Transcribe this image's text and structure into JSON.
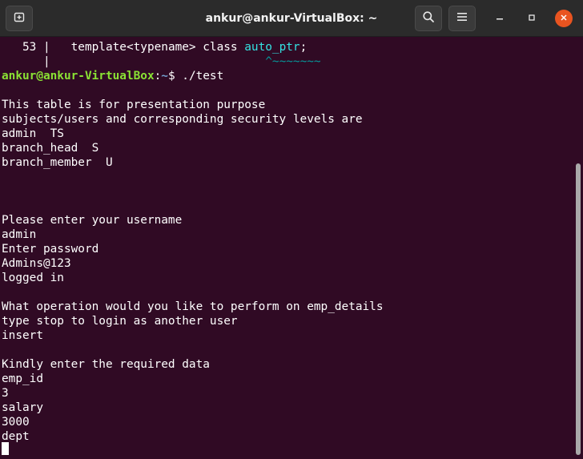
{
  "window": {
    "title": "ankur@ankur-VirtualBox: ~",
    "buttons": {
      "new_tab_icon": "new-tab-icon",
      "search_icon": "search-icon",
      "menu_icon": "hamburger-menu-icon",
      "minimize_icon": "minimize-icon",
      "maximize_icon": "maximize-icon",
      "close_icon": "close-icon"
    }
  },
  "terminal": {
    "colors": {
      "background": "#300a24",
      "text": "#ffffff",
      "prompt_user": "#8ae234",
      "prompt_path": "#729fcf",
      "highlight": "#34e2e2",
      "close_button": "#e95420"
    },
    "compiler_note": {
      "line_number": "   53 |",
      "code_before": "   template<typename> class ",
      "code_highlight": "auto_ptr",
      "code_after": ";",
      "gutter": "      |",
      "caret_pad": "                               ",
      "caret": "^~~~~~~~"
    },
    "prompt": {
      "user_host": "ankur@ankur-VirtualBox",
      "separator": ":",
      "path": "~",
      "symbol": "$ ",
      "command": "./test"
    },
    "output": [
      "",
      "This table is for presentation purpose",
      "subjects/users and corresponding security levels are",
      "admin  TS",
      "branch_head  S",
      "branch_member  U",
      "",
      "",
      "",
      "Please enter your username",
      "admin",
      "Enter password",
      "Admins@123",
      "logged in",
      "",
      "What operation would you like to perform on emp_details",
      "type stop to login as another user",
      "insert",
      "",
      "Kindly enter the required data",
      "emp_id",
      "3",
      "salary",
      "3000",
      "dept"
    ]
  }
}
